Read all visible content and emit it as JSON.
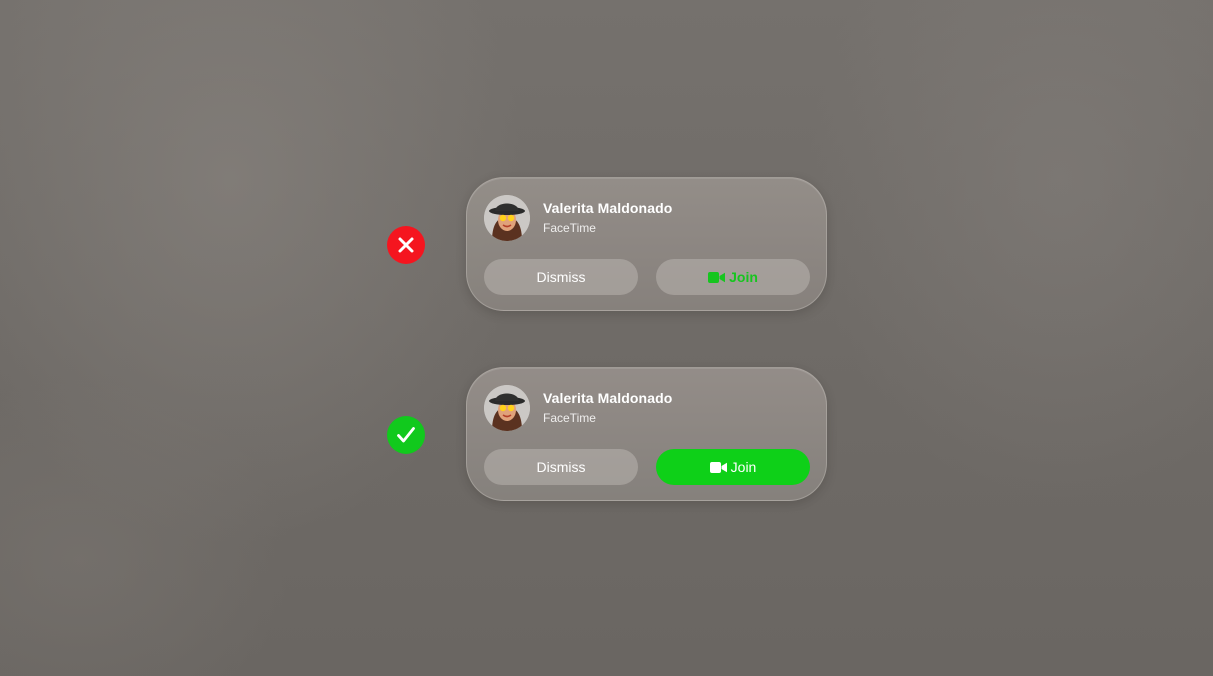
{
  "colors": {
    "bad_marker": "#f5151f",
    "good_marker": "#11c91d",
    "join_green": "#0ed018"
  },
  "examples": [
    {
      "verdict_icon": "x-mark-icon",
      "caller_name": "Valerita Maldonado",
      "app_name": "FaceTime",
      "dismiss_label": "Dismiss",
      "join_label": "Join",
      "join_icon": "video-camera-icon",
      "join_style": "green text on translucent button"
    },
    {
      "verdict_icon": "checkmark-icon",
      "caller_name": "Valerita Maldonado",
      "app_name": "FaceTime",
      "dismiss_label": "Dismiss",
      "join_label": "Join",
      "join_icon": "video-camera-icon",
      "join_style": "white text on solid green button"
    }
  ]
}
